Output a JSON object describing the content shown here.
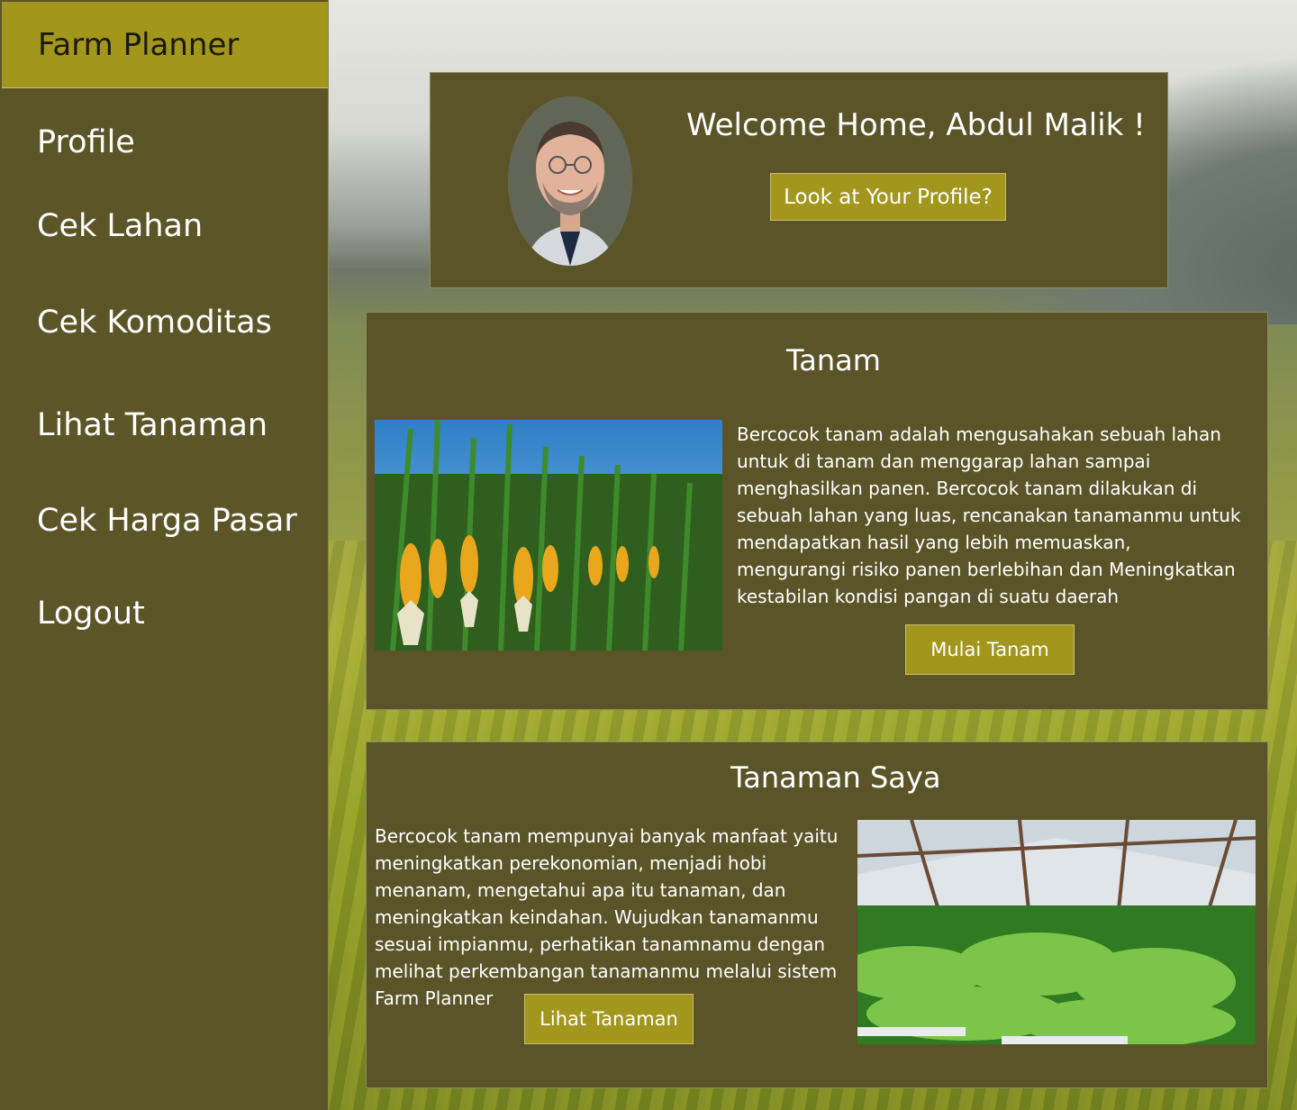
{
  "brand": "Farm Planner",
  "nav": [
    "Profile",
    "Cek Lahan",
    "Cek Komoditas",
    "Lihat Tanaman",
    "Cek Harga Pasar",
    "Logout"
  ],
  "welcome": {
    "title": "Welcome Home, Abdul Malik !",
    "profile_button": "Look at Your Profile?"
  },
  "tanam": {
    "title": "Tanam",
    "text": "Bercocok tanam adalah mengusahakan sebuah lahan untuk di tanam dan menggarap lahan sampai menghasilkan panen. Bercocok tanam dilakukan di sebuah lahan yang luas, rencanakan tanamanmu untuk mendapatkan hasil yang lebih memuaskan, mengurangi risiko panen berlebihan dan Meningkatkan kestabilan kondisi pangan di suatu daerah",
    "button": "Mulai Tanam"
  },
  "tanaman_saya": {
    "title": "Tanaman Saya",
    "text": "Bercocok tanam mempunyai banyak manfaat yaitu meningkatkan perekonomian, menjadi hobi menanam, mengetahui apa itu tanaman, dan meningkatkan keindahan. Wujudkan tanamanmu sesuai impianmu, perhatikan tanamnamu dengan melihat perkembangan tanamanmu melalui sistem Farm Planner",
    "button": "Lihat Tanaman"
  },
  "colors": {
    "sidebar": "#5c5528",
    "brand": "#a2961d",
    "panel": "#5b5428",
    "button": "#a2961d"
  }
}
